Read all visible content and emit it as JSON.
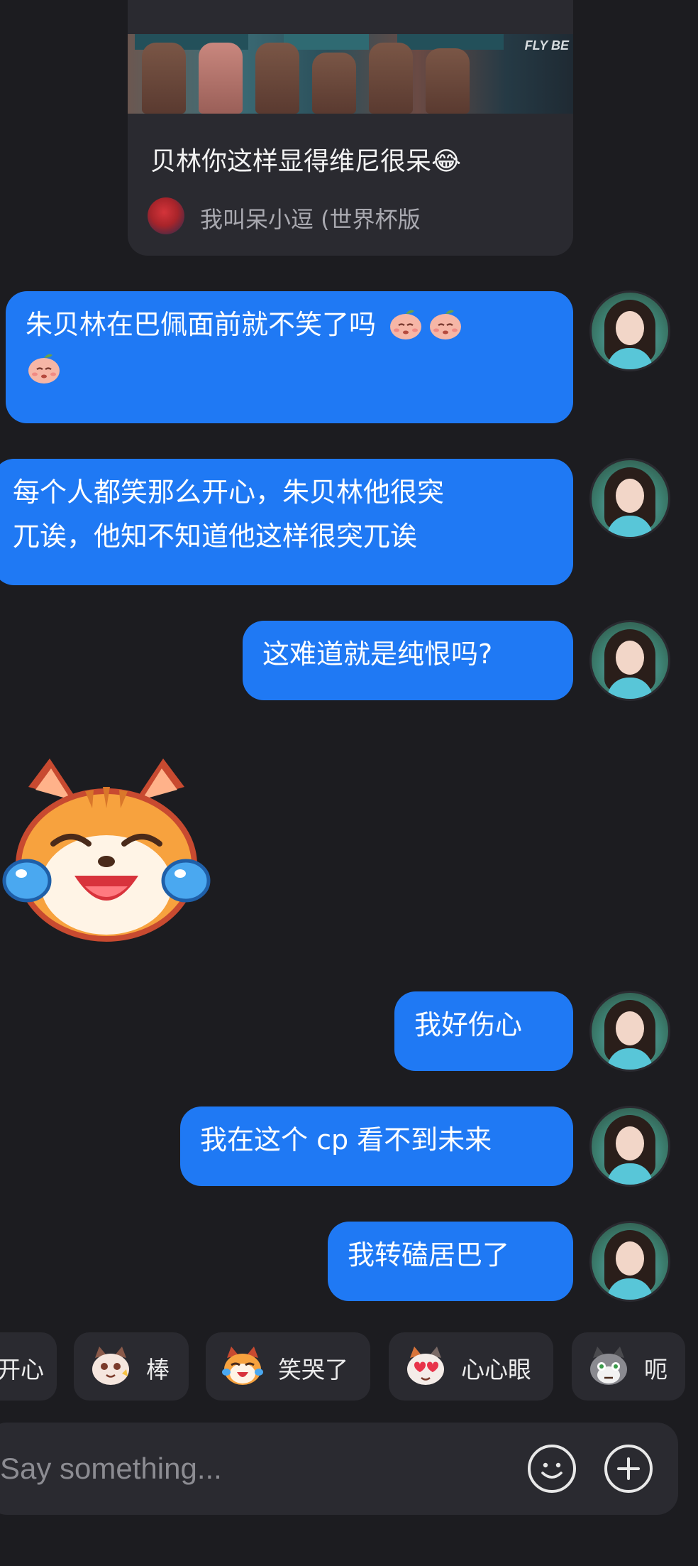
{
  "shared_post": {
    "image_text": "FLY BE",
    "title": "贝林你这样显得维尼很呆😂",
    "author": "我叫呆小逗 (世界杯版"
  },
  "messages": [
    {
      "type": "text",
      "lines": [
        "朱贝林在巴佩面前就不笑了吗",
        ""
      ],
      "emojis": 3
    },
    {
      "type": "text",
      "lines": [
        "每个人都笑那么开心，朱贝林他很突",
        "兀诶，他知不知道他这样很突兀诶"
      ]
    },
    {
      "type": "text",
      "lines": [
        "这难道就是纯恨吗?"
      ]
    },
    {
      "type": "sticker",
      "name": "laughing-crying-cat"
    },
    {
      "type": "text",
      "lines": [
        "我好伤心"
      ]
    },
    {
      "type": "text",
      "lines": [
        "我在这个 cp 看不到未来"
      ]
    },
    {
      "type": "text",
      "lines": [
        "我转磕居巴了"
      ]
    }
  ],
  "quick_reactions": [
    {
      "label": "开心",
      "icon": "happy-cat-icon"
    },
    {
      "label": "棒",
      "icon": "thumbs-cat-icon"
    },
    {
      "label": "笑哭了",
      "icon": "laugh-cry-cat-icon"
    },
    {
      "label": "心心眼",
      "icon": "heart-eyes-cat-icon"
    },
    {
      "label": "呃",
      "icon": "awkward-cat-icon"
    }
  ],
  "input": {
    "placeholder": "Say something..."
  },
  "colors": {
    "background": "#1c1c20",
    "bubble": "#1f79f4",
    "card": "#2a2a30"
  }
}
